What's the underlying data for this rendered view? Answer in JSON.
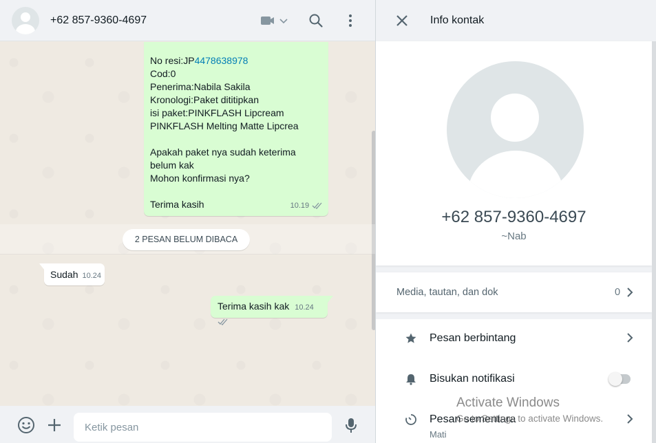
{
  "chat": {
    "header": {
      "title": "+62 857-9360-4697"
    },
    "messages": {
      "outgoing_main": {
        "lines": [
          "Cod:0",
          "Penerima:Nabila Sakila",
          "Kronologi:Paket dititipkan",
          "isi paket:PINKFLASH Lipcream",
          "PINKFLASH Melting Matte Lipcrea"
        ],
        "resi_prefix": "No resi:JP",
        "resi_link": "4478638978",
        "lines2": [
          "Apakah paket nya sudah keterima",
          "belum kak",
          "Mohon konfirmasi nya?"
        ],
        "closing": "Terima kasih",
        "time": "10.19"
      },
      "unread_banner": "2 PESAN BELUM DIBACA",
      "incoming_1": {
        "text": "Sudah",
        "time": "10.24"
      },
      "outgoing_2": {
        "text": "Terima kasih kak",
        "time": "10.24"
      }
    },
    "footer": {
      "placeholder": "Ketik pesan"
    }
  },
  "info": {
    "title": "Info kontak",
    "phone": "+62 857-9360-4697",
    "alias": "~Nab",
    "media": {
      "label": "Media, tautan, dan dok",
      "count": "0"
    },
    "settings": [
      {
        "label": "Pesan berbintang",
        "icon": "star-icon"
      },
      {
        "label": "Bisukan notifikasi",
        "icon": "bell-icon",
        "toggle_on": false
      },
      {
        "label": "Pesan sementara",
        "sub": "Mati",
        "icon": "timer-icon"
      }
    ]
  },
  "watermark": {
    "title": "Activate Windows",
    "subtitle": "Go to Settings to activate Windows."
  },
  "colors": {
    "outgoing_bubble": "#d9fdd3",
    "chat_bg": "#efeae2",
    "panel_bg": "#f0f2f5",
    "link": "#027eb5"
  }
}
